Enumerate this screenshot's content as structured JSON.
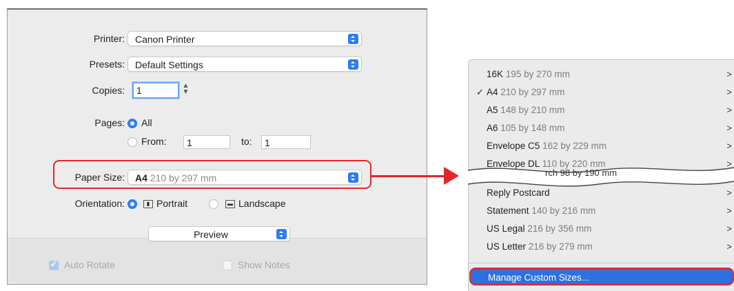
{
  "dialog": {
    "printer_label": "Printer:",
    "printer_value": "Canon Printer",
    "presets_label": "Presets:",
    "presets_value": "Default Settings",
    "copies_label": "Copies:",
    "copies_value": "1",
    "pages_label": "Pages:",
    "pages_all": "All",
    "pages_from": "From:",
    "pages_from_value": "1",
    "pages_to": "to:",
    "pages_to_value": "1",
    "paper_size_label": "Paper Size:",
    "paper_size_name": "A4",
    "paper_size_dims": "210 by 297 mm",
    "orientation_label": "Orientation:",
    "portrait": "Portrait",
    "landscape": "Landscape",
    "app_menu_value": "Preview",
    "auto_rotate": "Auto Rotate",
    "show_notes": "Show Notes"
  },
  "menu": {
    "items": [
      {
        "name": "16K",
        "dims": "195 by 270 mm",
        "checked": false
      },
      {
        "name": "A4",
        "dims": "210 by 297 mm",
        "checked": true
      },
      {
        "name": "A5",
        "dims": "148 by 210 mm",
        "checked": false
      },
      {
        "name": "A6",
        "dims": "105 by 148 mm",
        "checked": false
      },
      {
        "name": "Envelope C5",
        "dims": "162 by 229 mm",
        "checked": false
      },
      {
        "name": "Envelope DL",
        "dims": "110 by 220 mm",
        "checked": false
      },
      {
        "name": "Reply Postcard",
        "dims": "",
        "checked": false
      },
      {
        "name": "Statement",
        "dims": "140 by 216 mm",
        "checked": false
      },
      {
        "name": "US Legal",
        "dims": "216 by 356 mm",
        "checked": false
      },
      {
        "name": "US Letter",
        "dims": "216 by 279 mm",
        "checked": false
      }
    ],
    "torn_fragment": "rch 98 by 190 mm",
    "chevron": ">",
    "tick": "✓",
    "manage_custom": "Manage Custom Sizes..."
  },
  "colors": {
    "accent": "#2a7ef5",
    "highlight": "#e3262a",
    "menu_selected": "#2f6fde"
  }
}
